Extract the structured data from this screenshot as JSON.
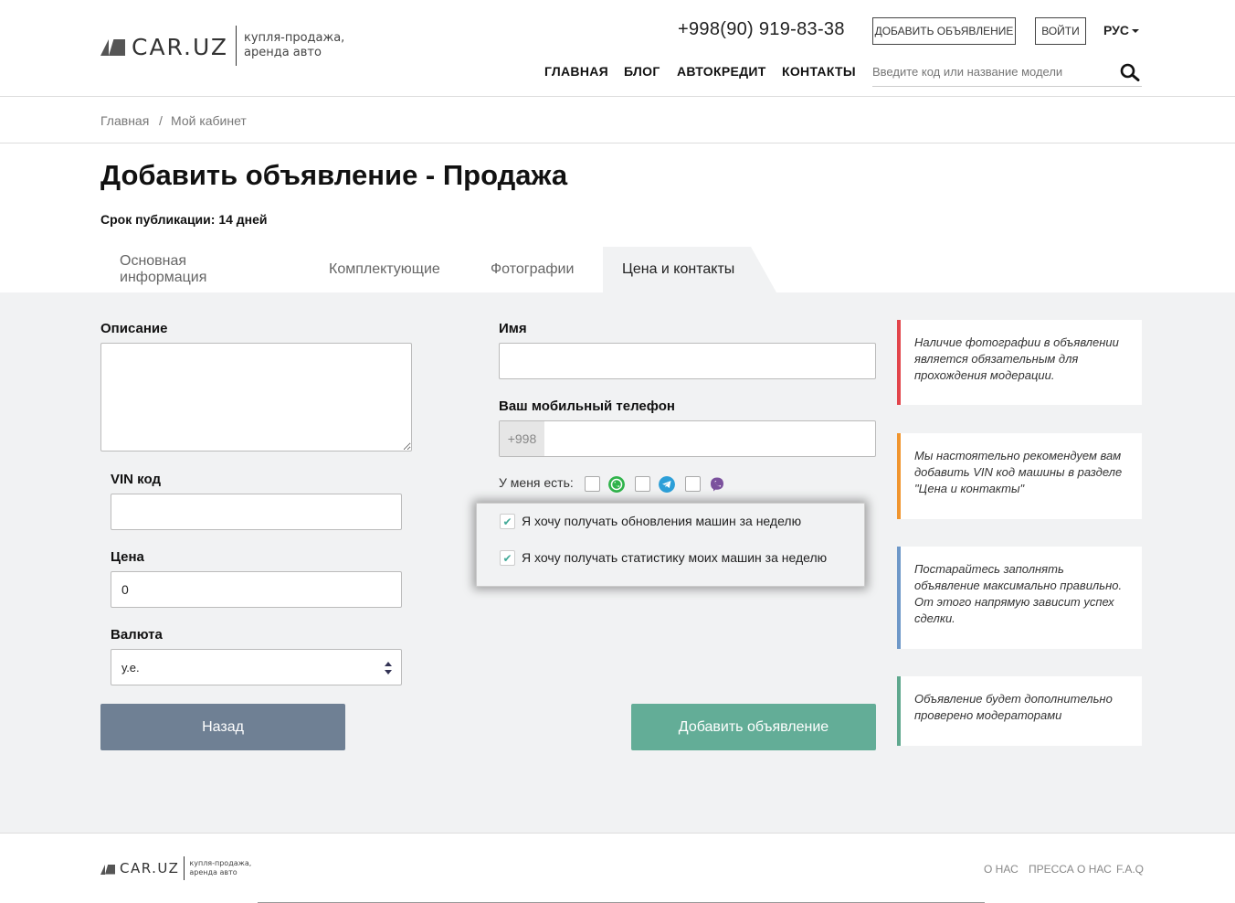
{
  "header": {
    "logo_text": "CAR.UZ",
    "logo_sub_1": "купля-продажа,",
    "logo_sub_2": "аренда авто",
    "phone": "+998(90) 919-83-38",
    "add_button": "ДОБАВИТЬ ОБЪЯВЛЕНИЕ",
    "login_button": "ВОЙТИ",
    "language": "РУС",
    "nav": [
      "ГЛАВНАЯ",
      "БЛОГ",
      "АВТОКРЕДИТ",
      "КОНТАКТЫ"
    ],
    "search_placeholder": "Введите код или название модели"
  },
  "breadcrumb": {
    "home": "Главная",
    "sep": "/",
    "current": "Мой кабинет"
  },
  "page": {
    "title": "Добавить объявление - Продажа",
    "publication_term": "Срок публикации: 14 дней"
  },
  "tabs": [
    {
      "label": "Основная информация",
      "active": false
    },
    {
      "label": "Комплектующие",
      "active": false
    },
    {
      "label": "Фотографии",
      "active": false
    },
    {
      "label": "Цена и контакты",
      "active": true
    }
  ],
  "form": {
    "description_label": "Описание",
    "description_value": "",
    "vin_label": "VIN код",
    "vin_value": "",
    "price_label": "Цена",
    "price_value": "0",
    "currency_label": "Валюта",
    "currency_value": "у.е.",
    "name_label": "Имя",
    "name_value": "",
    "phone_label": "Ваш мобильный телефон",
    "phone_prefix": "+998",
    "messengers_label": "У меня есть:",
    "messengers": [
      "whatsapp",
      "telegram",
      "viber"
    ],
    "subscribe_updates": "Я хочу получать обновления машин за неделю",
    "subscribe_stats": "Я хочу получать статистику моих машин за неделю",
    "back_button": "Назад",
    "submit_button": "Добавить объявление"
  },
  "notes": [
    {
      "text": "Наличие фотографии в объявлении является обязательным для прохождения модерации.",
      "color": "#e2454b"
    },
    {
      "text": "Мы настоятельно рекомендуем вам добавить VIN код машины в разделе \"Цена и контакты\"",
      "color": "#f0952e"
    },
    {
      "text": "Постарайтесь заполнять объявление максимально правильно. От этого напрямую зависит успех сделки.",
      "color": "#6e98c8"
    },
    {
      "text": "Объявление будет дополнительно проверено модераторами",
      "color": "#5fa88e"
    }
  ],
  "colors": {
    "back": "#6f8094",
    "submit": "#63ad97",
    "main_bg": "#f1f2f3"
  },
  "footer": {
    "links": [
      "О НАС",
      "ПРЕССА О НАС",
      "F.A.Q"
    ]
  }
}
